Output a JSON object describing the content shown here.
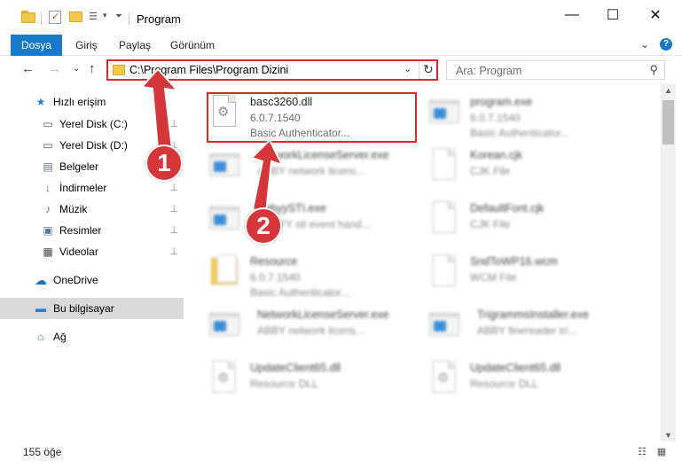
{
  "window": {
    "title": "Program",
    "minimize_glyph": "—",
    "maximize_glyph": "☐",
    "close_glyph": "✕"
  },
  "ribbon": {
    "tabs": [
      "Dosya",
      "Giriş",
      "Paylaş",
      "Görünüm"
    ],
    "expand_glyph": "⌄",
    "help_glyph": "?"
  },
  "address": {
    "path": "C:\\Program Files\\Program Dizini",
    "dropdown_glyph": "⌄",
    "refresh_glyph": "↻"
  },
  "nav": {
    "back_glyph": "←",
    "forward_glyph": "→",
    "recent_glyph": "⌄",
    "up_glyph": "↑"
  },
  "search": {
    "placeholder": "Ara: Program",
    "icon_glyph": "⚲"
  },
  "sidebar": {
    "items": [
      {
        "label": "Hızlı erişim",
        "icon": "star-icon",
        "glyph": "★",
        "pinned": false
      },
      {
        "label": "Yerel Disk (C:)",
        "icon": "drive-icon",
        "glyph": "▭",
        "pinned": true
      },
      {
        "label": "Yerel Disk (D:)",
        "icon": "drive-icon",
        "glyph": "▭",
        "pinned": true
      },
      {
        "label": "Belgeler",
        "icon": "documents-icon",
        "glyph": "▤",
        "pinned": true
      },
      {
        "label": "İndirmeler",
        "icon": "download-icon",
        "glyph": "↓",
        "pinned": true
      },
      {
        "label": "Müzik",
        "icon": "music-icon",
        "glyph": "♪",
        "pinned": true
      },
      {
        "label": "Resimler",
        "icon": "pictures-icon",
        "glyph": "▣",
        "pinned": true
      },
      {
        "label": "Videolar",
        "icon": "video-icon",
        "glyph": "▦",
        "pinned": true
      },
      {
        "label": "OneDrive",
        "icon": "cloud-icon",
        "glyph": "☁",
        "pinned": false
      },
      {
        "label": "Bu bilgisayar",
        "icon": "computer-icon",
        "glyph": "▬",
        "pinned": false
      },
      {
        "label": "Ağ",
        "icon": "network-icon",
        "glyph": "⌂",
        "pinned": false
      }
    ],
    "pin_glyph": "⊥"
  },
  "files": [
    {
      "name": "basc3260.dll",
      "line1": "6.0.7.1540",
      "line2": "Basic Authenticator...",
      "icon": "dll-icon"
    },
    {
      "name": "program.exe",
      "line1": "6.0.7.1540",
      "line2": "Basic Authenticator...",
      "icon": "exe-icon"
    },
    {
      "name": "NetworkLicenseServer.exe",
      "line1": "ABBY network licens...",
      "line2": "",
      "icon": "exe-icon"
    },
    {
      "name": "Korean.cjk",
      "line1": "CJK File",
      "line2": "",
      "icon": "file-icon"
    },
    {
      "name": "AbbyySTI.exe",
      "line1": "ABBYY sti event hand...",
      "line2": "",
      "icon": "exe-icon"
    },
    {
      "name": "DefaultFont.cjk",
      "line1": "CJK File",
      "line2": "",
      "icon": "file-icon"
    },
    {
      "name": "Resource",
      "line1": "6.0.7.1540",
      "line2": "Basic Authenticator...",
      "icon": "folder-icon"
    },
    {
      "name": "SndToWP16.wcm",
      "line1": "WCM File",
      "line2": "",
      "icon": "file-icon"
    },
    {
      "name": "NetworkLicenseServer.exe",
      "line1": "ABBY network licens...",
      "line2": "",
      "icon": "exe-icon"
    },
    {
      "name": "TrigrammsInstaller.exe",
      "line1": "ABBY finereader tri...",
      "line2": "",
      "icon": "exe-icon"
    },
    {
      "name": "UpdateClient65.dll",
      "line1": "Resource DLL",
      "line2": "",
      "icon": "dll-icon"
    },
    {
      "name": "UpdateClient65.dll",
      "line1": "Resource DLL",
      "line2": "",
      "icon": "dll-icon"
    }
  ],
  "annotations": {
    "callout1": "1",
    "callout2": "2",
    "highlight_color": "#e0272d",
    "arrow_color": "#d4363a"
  },
  "status": {
    "count": "155 öğe"
  }
}
